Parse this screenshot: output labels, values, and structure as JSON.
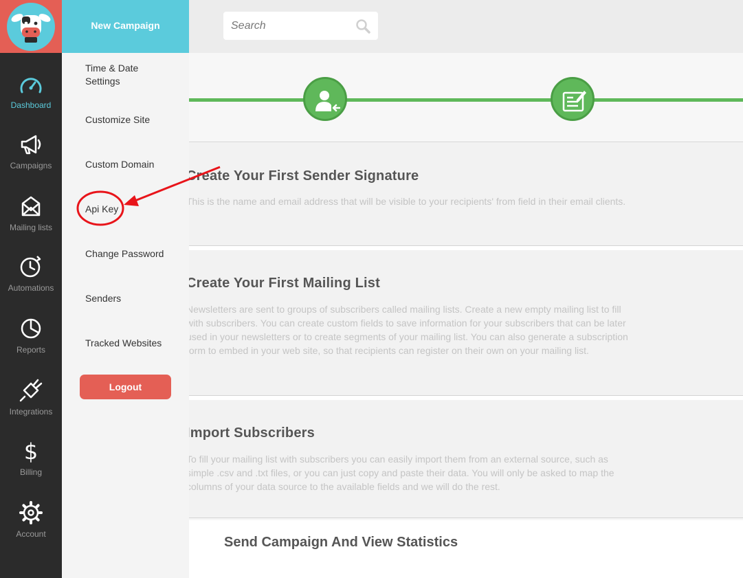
{
  "rail": {
    "items": [
      {
        "label": "Dashboard",
        "icon": "gauge-icon",
        "active": true
      },
      {
        "label": "Campaigns",
        "icon": "megaphone-icon"
      },
      {
        "label": "Mailing lists",
        "icon": "envelope-icon"
      },
      {
        "label": "Automations",
        "icon": "clock-icon"
      },
      {
        "label": "Reports",
        "icon": "pie-chart-icon"
      },
      {
        "label": "Integrations",
        "icon": "plug-icon"
      },
      {
        "label": "Billing",
        "icon": "dollar-icon"
      },
      {
        "label": "Account",
        "icon": "gear-icon"
      }
    ]
  },
  "submenu": {
    "new_campaign": "New Campaign",
    "items": [
      {
        "label": "Time & Date Settings"
      },
      {
        "label": "Customize Site"
      },
      {
        "label": "Custom Domain"
      },
      {
        "label": "Api Key"
      },
      {
        "label": "Change Password"
      },
      {
        "label": "Senders"
      },
      {
        "label": "Tracked Websites"
      }
    ],
    "logout": "Logout"
  },
  "search": {
    "placeholder": "Search"
  },
  "sections": [
    {
      "title": "Create Your First Sender Signature",
      "body": "This is the name and email address that will be visible to your recipients' from field in their email clients."
    },
    {
      "title": "Create Your First Mailing List",
      "body": "Newsletters are sent to groups of subscribers called mailing lists. Create a new empty mailing list to fill with subscribers. You can create custom fields to save information for your subscribers that can be later used in your newsletters or to create segments of your mailing list. You can also generate a subscription form to embed in your web site, so that recipients can register on their own on your mailing list."
    },
    {
      "title": "Import Subscribers",
      "body": "To fill your mailing list with subscribers you can easily import them from an external source, such as simple .csv and .txt files, or you can just copy and paste their data. You will only be asked to map the columns of your data source to the available fields and we will do the rest."
    },
    {
      "title": "Send Campaign And View Statistics"
    }
  ],
  "colors": {
    "accent": "#5bcbdc",
    "brand_red": "#e45f55",
    "progress_green": "#5fb85a",
    "annotation_red": "#e8141a"
  }
}
